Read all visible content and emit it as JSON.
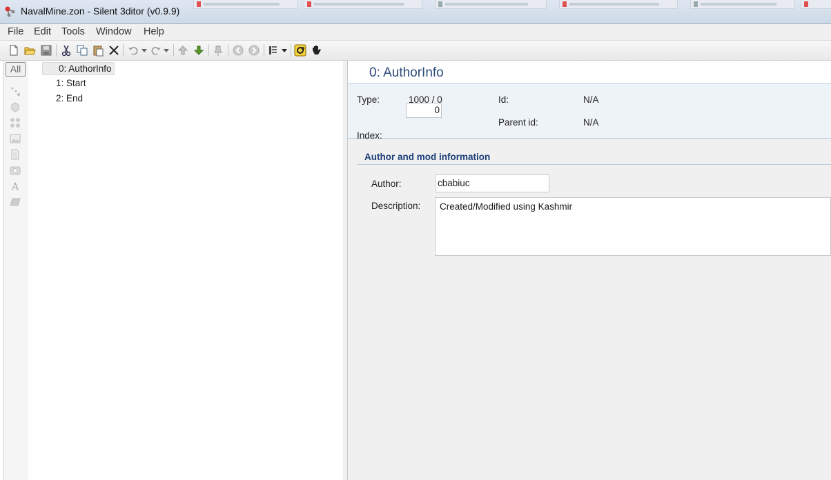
{
  "window": {
    "title": "NavalMine.zon - Silent 3ditor (v0.9.9)"
  },
  "menu": [
    "File",
    "Edit",
    "Tools",
    "Window",
    "Help"
  ],
  "toolbar": {
    "buttons": [
      "new-icon",
      "open-icon",
      "save-icon",
      "cut-icon",
      "copy-icon",
      "paste-icon",
      "delete-icon",
      "undo-icon",
      "redo-icon",
      "move-up-icon",
      "move-down-icon",
      "pin-icon",
      "back-icon",
      "forward-icon",
      "view-list-icon",
      "refresh-icon",
      "hand-icon"
    ]
  },
  "filter_strip": {
    "all_label": "All",
    "icons": [
      "node-icon",
      "cube-icon",
      "group-icon",
      "image-icon",
      "document-icon",
      "camera-icon",
      "text-icon",
      "plane-icon"
    ]
  },
  "tree": {
    "items": [
      "0: AuthorInfo",
      "1: Start",
      "2: End"
    ],
    "selected_index": 0
  },
  "detail": {
    "title": "0: AuthorInfo",
    "type_label": "Type:",
    "type_value": "1000 / 0",
    "id_label": "Id:",
    "id_value": "N/A",
    "parent_label": "Parent id:",
    "parent_value": "N/A",
    "index_label": "Index:",
    "index_value": "0",
    "section_title": "Author and mod information",
    "author_label": "Author:",
    "author_value": "cbabiuc",
    "description_label": "Description:",
    "description_value": "Created/Modified using Kashmir"
  }
}
